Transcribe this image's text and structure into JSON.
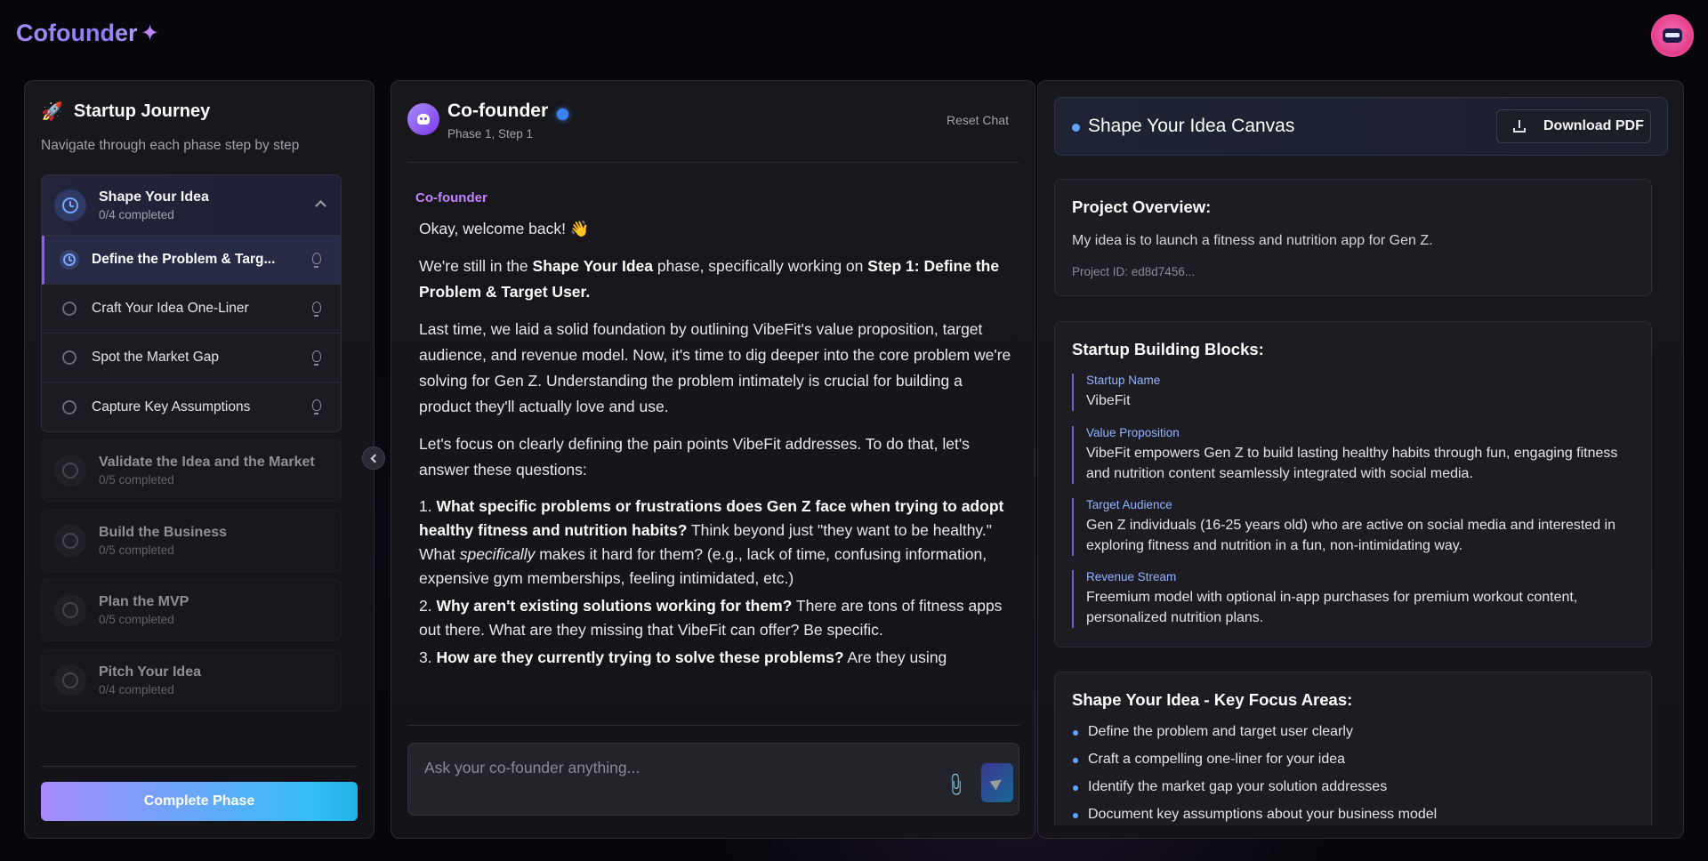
{
  "app": {
    "logo_text": "Cofounder",
    "logo_icon": "sparkle-icon"
  },
  "journey": {
    "title": "Startup Journey",
    "subtitle": "Navigate through each phase step by step",
    "current_phase": {
      "name": "Shape Your Idea",
      "count": "0/4 completed",
      "steps": [
        {
          "label": "Define the Problem & Targ...",
          "active": true
        },
        {
          "label": "Craft Your Idea One-Liner",
          "active": false
        },
        {
          "label": "Spot the Market Gap",
          "active": false
        },
        {
          "label": "Capture Key Assumptions",
          "active": false
        }
      ]
    },
    "phases": [
      {
        "name": "Validate the Idea and the Market",
        "count": "0/5 completed"
      },
      {
        "name": "Build the Business",
        "count": "0/5 completed"
      },
      {
        "name": "Plan the MVP",
        "count": "0/5 completed"
      },
      {
        "name": "Pitch Your Idea",
        "count": "0/4 completed"
      }
    ],
    "complete_button": "Complete Phase"
  },
  "chat": {
    "name": "Co-founder",
    "phase_step": "Phase 1, Step 1",
    "reset_label": "Reset Chat",
    "sender": "Co-founder",
    "greeting": "Okay, welcome back! 👋",
    "p1_a": "We're still in the ",
    "p1_b": "Shape Your Idea",
    "p1_c": " phase, specifically working on ",
    "p1_d": "Step 1: Define the Problem & Target User.",
    "p2": "Last time, we laid a solid foundation by outlining VibeFit's value proposition, target audience, and revenue model. Now, it's time to dig deeper into the core problem we're solving for Gen Z. Understanding the problem intimately is crucial for building a product they'll actually love and use.",
    "p3": "Let's focus on clearly defining the pain points VibeFit addresses. To do that, let's answer these questions:",
    "q1_num": "1. ",
    "q1_bold": "What specific problems or frustrations does Gen Z face when trying to adopt healthy fitness and nutrition habits?",
    "q1_a": " Think beyond just \"they want to be healthy.\" What ",
    "q1_em": "specifically",
    "q1_b": " makes it hard for them? (e.g., lack of time, confusing information, expensive gym memberships, feeling intimidated, etc.)",
    "q2_num": "2. ",
    "q2_bold": "Why aren't existing solutions working for them?",
    "q2_rest": " There are tons of fitness apps out there. What are they missing that VibeFit can offer? Be specific.",
    "q3_num": "3. ",
    "q3_bold": "How are they currently trying to solve these problems?",
    "q3_rest": " Are they using",
    "input_placeholder": "Ask your co-founder anything..."
  },
  "canvas": {
    "title": "Shape Your Idea Canvas",
    "download_label": "Download PDF",
    "overview_title": "Project Overview:",
    "overview_text": "My idea is to launch a fitness and nutrition app for Gen Z.",
    "project_id": "Project ID: ed8d7456...",
    "blocks_title": "Startup Building Blocks:",
    "blocks": [
      {
        "label": "Startup Name",
        "value": "VibeFit"
      },
      {
        "label": "Value Proposition",
        "value": "VibeFit empowers Gen Z to build lasting healthy habits through fun, engaging fitness and nutrition content seamlessly integrated with social media."
      },
      {
        "label": "Target Audience",
        "value": "Gen Z individuals (16-25 years old) who are active on social media and interested in exploring fitness and nutrition in a fun, non-intimidating way."
      },
      {
        "label": "Revenue Stream",
        "value": "Freemium model with optional in-app purchases for premium workout content, personalized nutrition plans."
      }
    ],
    "focus_title": "Shape Your Idea - Key Focus Areas:",
    "focus_items": [
      "Define the problem and target user clearly",
      "Craft a compelling one-liner for your idea",
      "Identify the market gap your solution addresses",
      "Document key assumptions about your business model"
    ]
  },
  "colors": {
    "accent_purple": "#8b5cf6",
    "accent_blue": "#3b82f6",
    "cta_start": "#a78bfa",
    "cta_end": "#22b3e6"
  }
}
